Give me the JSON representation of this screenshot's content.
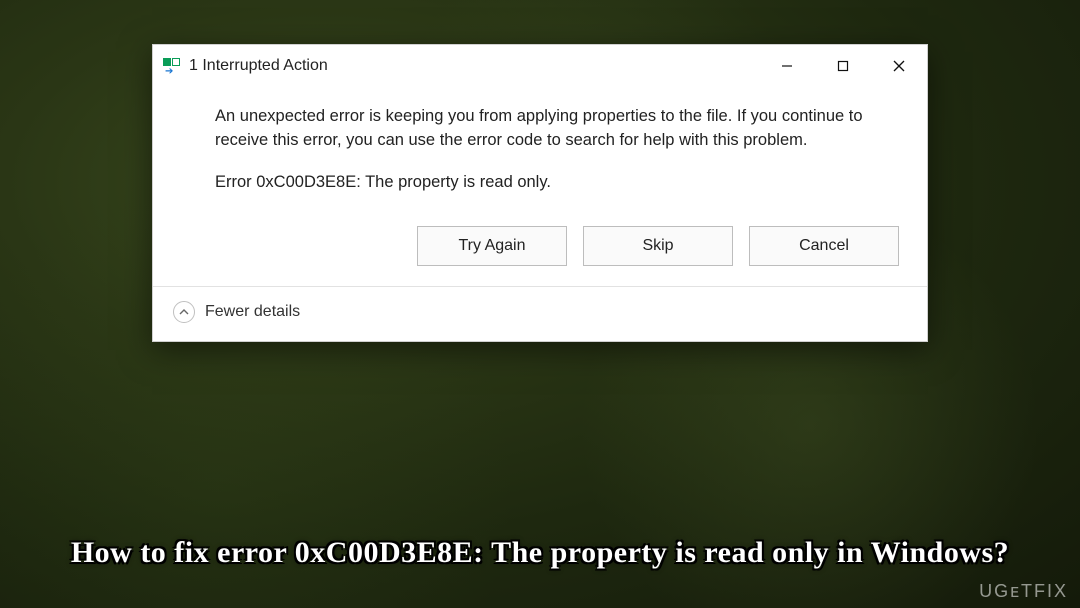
{
  "dialog": {
    "title": "1 Interrupted Action",
    "message": "An unexpected error is keeping you from applying properties to the file. If you continue to receive this error, you can use the error code to search for help with this problem.",
    "error_line": "Error 0xC00D3E8E: The property is read only.",
    "buttons": {
      "try_again": "Try Again",
      "skip": "Skip",
      "cancel": "Cancel"
    },
    "footer": {
      "toggle_label": "Fewer details"
    }
  },
  "caption": "How to fix error 0xC00D3E8E: The property is read only in Windows?",
  "watermark": "UGETFIX"
}
